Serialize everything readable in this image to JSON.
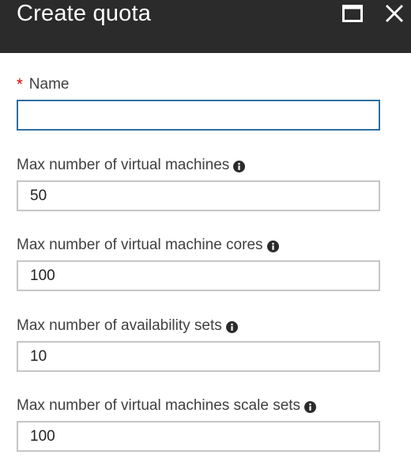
{
  "window": {
    "title": "Create quota",
    "maximize_icon": "maximize-icon",
    "close_icon": "close-icon"
  },
  "form": {
    "required_marker": "*",
    "fields": [
      {
        "label": "Name",
        "value": "",
        "required": true,
        "info": false,
        "focused": true
      },
      {
        "label": "Max number of virtual machines",
        "value": "50",
        "required": false,
        "info": true
      },
      {
        "label": "Max number of virtual machine cores",
        "value": "100",
        "required": false,
        "info": true
      },
      {
        "label": "Max number of availability sets",
        "value": "10",
        "required": false,
        "info": true
      },
      {
        "label": "Max number of virtual machines scale sets",
        "value": "100",
        "required": false,
        "info": true
      }
    ]
  },
  "colors": {
    "titlebar_bg": "#2b2b2b",
    "required": "#d00000",
    "focus_border": "#2d6fa1",
    "input_border": "#c6c6c6"
  }
}
